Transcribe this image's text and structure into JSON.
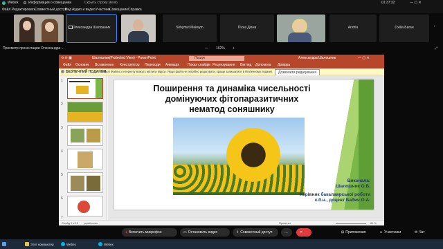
{
  "window": {
    "app_name": "Webex",
    "status": "Информация о совещании",
    "search_placeholder": "Скрыть строку меню",
    "time": "01:37:32"
  },
  "menu": [
    "Файл",
    "Редактировать",
    "Совместный доступ",
    "Вид",
    "Аудио и видео",
    "Участник",
    "Совещание",
    "Справка"
  ],
  "participants": [
    {
      "name": "",
      "type": "video"
    },
    {
      "name": "Олександра Шалошник",
      "type": "name",
      "selected": true
    },
    {
      "name": "",
      "type": "video-man"
    },
    {
      "name": "Skhymut Maksym",
      "type": "name"
    },
    {
      "name": "Піска Діана",
      "type": "name"
    },
    {
      "name": "",
      "type": "video-woman"
    },
    {
      "name": "Andriu",
      "type": "name"
    },
    {
      "name": "Oxilla Баган",
      "type": "name"
    }
  ],
  "share": {
    "viewer_label": "Просмотр презентации Олександра ...",
    "zoom": "162%"
  },
  "ppt": {
    "title": "Шалошник(Protected View) - PowerPoint",
    "search": "Пошук",
    "user": "Александра Шалошник",
    "tabs": [
      "Файл",
      "Основне",
      "Вставлення",
      "Конструктор",
      "Переходи",
      "Анімація",
      "Показ слайдів",
      "Рецензування",
      "Вигляд",
      "Допомога",
      "Довідка"
    ],
    "protected_label": "БЕЗПЕЧНИЙ ПОДАННЯ",
    "protected_text": "Увага! Файли з Інтернету можуть містити віруси. Якщо файл не потрібно редагувати, краще залишатися в безпечному поданні.",
    "protected_button": "Дозволити редагування",
    "status_left": "Слайд 1 з 13",
    "status_lang": "українська",
    "status_notes": "Примітки",
    "status_zoom": "61 %"
  },
  "thumbs": [
    "1",
    "2",
    "3",
    "4",
    "5",
    "6",
    "7"
  ],
  "slide": {
    "title_line1": "Поширення та динаміка чисельності",
    "title_line2": "домінуючих фітопаразитичних",
    "title_line3": "нематод соняшнику",
    "author_label": "Виконала:",
    "author_name": "Шалошник О.В.",
    "supervisor_line1": "Керівник бакалаврської роботи",
    "supervisor_line2": "к.б.н., доцент Бабич О.А."
  },
  "controls": {
    "mic": "Включить микрофон",
    "video": "Остановить видео",
    "share": "Совместный доступ",
    "apps": "Приложения",
    "participants": "Участники",
    "chat": "Чат"
  },
  "taskbar": [
    "Этот компьютер",
    "Webex",
    "Webex",
    "Відео - ентомо_сh...",
    "Базовик - Webex - ...",
    "На сдаДОПОВІ_1...",
    "На сдаДОПОВІ_...",
    "Документ Microso..."
  ],
  "clock": {
    "time": "11:40",
    "date": "07.06.2021"
  },
  "colors": {
    "ppt_accent": "#b7472a",
    "slide_green": "#7ab648",
    "webex_red": "#e03a3a"
  }
}
